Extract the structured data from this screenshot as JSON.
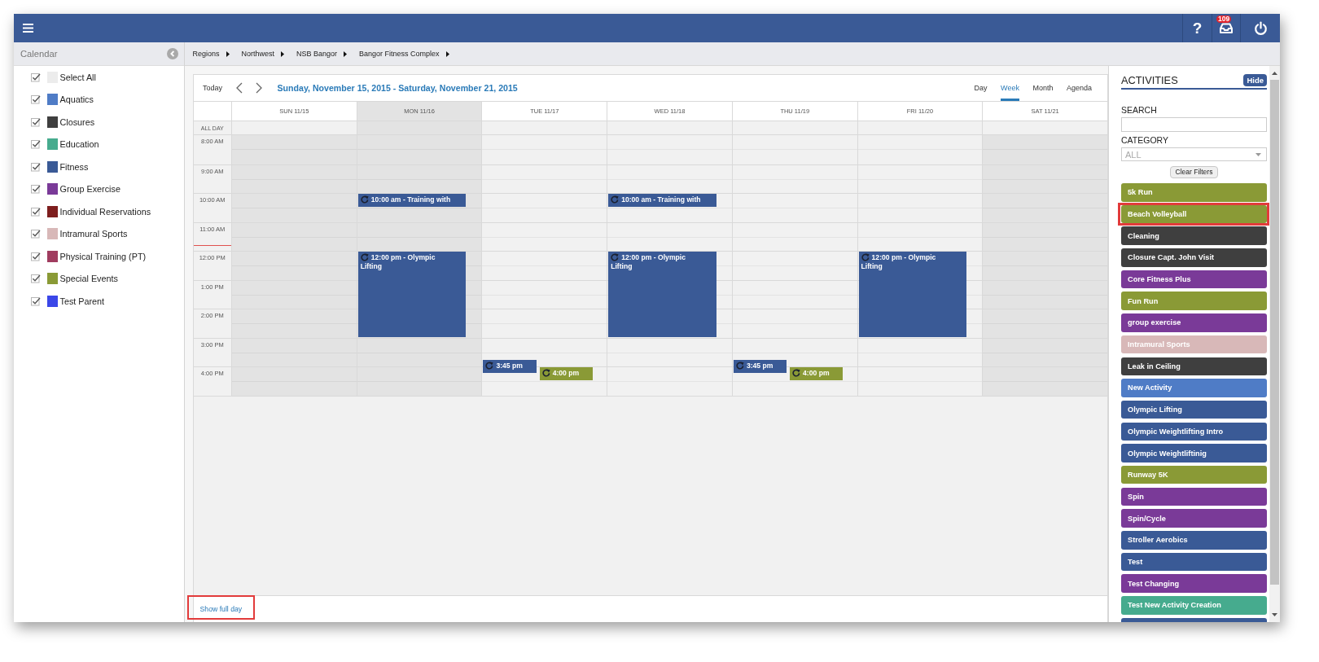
{
  "top_bar": {
    "help_label": "?",
    "notification_count": "109"
  },
  "sidebar": {
    "title": "Calendar",
    "items": [
      {
        "label": "Select All",
        "checked": true,
        "color": "#ececec"
      },
      {
        "label": "Aquatics",
        "checked": true,
        "color": "#4f7cc6"
      },
      {
        "label": "Closures",
        "checked": true,
        "color": "#3f3f3f"
      },
      {
        "label": "Education",
        "checked": true,
        "color": "#46ab8e"
      },
      {
        "label": "Fitness",
        "checked": true,
        "color": "#3a5a96"
      },
      {
        "label": "Group Exercise",
        "checked": true,
        "color": "#7a3a98"
      },
      {
        "label": "Individual Reservations",
        "checked": true,
        "color": "#7e1e1e"
      },
      {
        "label": "Intramural Sports",
        "checked": true,
        "color": "#d8b8b8"
      },
      {
        "label": "Physical Training (PT)",
        "checked": true,
        "color": "#a03c5f"
      },
      {
        "label": "Special Events",
        "checked": true,
        "color": "#8a9a36"
      },
      {
        "label": "Test Parent",
        "checked": true,
        "color": "#3b47e8"
      }
    ]
  },
  "breadcrumb": [
    "Regions",
    "Northwest",
    "NSB Bangor",
    "Bangor Fitness Complex"
  ],
  "calendar": {
    "today_button": "Today",
    "range_title": "Sunday, November 15, 2015 - Saturday, November 21, 2015",
    "views": [
      {
        "label": "Day",
        "selected": false
      },
      {
        "label": "Week",
        "selected": true
      },
      {
        "label": "Month",
        "selected": false
      },
      {
        "label": "Agenda",
        "selected": false
      }
    ],
    "all_day_label": "ALL DAY",
    "hours": [
      {
        "label": "8:00 AM",
        "now": false
      },
      {
        "label": "9:00 AM",
        "now": false
      },
      {
        "label": "10:00 AM",
        "now": false
      },
      {
        "label": "11:00 AM",
        "now": true
      },
      {
        "label": "12:00 PM",
        "now": false
      },
      {
        "label": "1:00 PM",
        "now": false
      },
      {
        "label": "2:00 PM",
        "now": false
      },
      {
        "label": "3:00 PM",
        "now": false
      },
      {
        "label": "4:00 PM",
        "now": false
      }
    ],
    "days": [
      {
        "label": "SUN 11/15",
        "today": false,
        "closed": true
      },
      {
        "label": "MON 11/16",
        "today": true,
        "closed": false,
        "events": [
          {
            "label": "10:00 am - Training with",
            "kind": "short",
            "color": "#3a5a96",
            "recurring": true
          },
          {
            "label": "12:00 pm - Olympic Lifting",
            "kind": "long",
            "color": "#3a5a96",
            "recurring": true
          }
        ]
      },
      {
        "label": "TUE 11/17",
        "today": false,
        "closed": false,
        "events": [
          {
            "label": "3:45 pm",
            "kind": "short",
            "color": "#3a5a96",
            "recurring": true
          },
          {
            "label": "4:00 pm",
            "kind": "short",
            "color": "#8a9a36",
            "recurring": true
          }
        ]
      },
      {
        "label": "WED 11/18",
        "today": false,
        "closed": false,
        "events": [
          {
            "label": "10:00 am - Training with",
            "kind": "short",
            "color": "#3a5a96",
            "recurring": true
          },
          {
            "label": "12:00 pm - Olympic Lifting",
            "kind": "long",
            "color": "#3a5a96",
            "recurring": true
          }
        ]
      },
      {
        "label": "THU 11/19",
        "today": false,
        "closed": false,
        "events": [
          {
            "label": "3:45 pm",
            "kind": "short",
            "color": "#3a5a96",
            "recurring": true
          },
          {
            "label": "4:00 pm",
            "kind": "short",
            "color": "#8a9a36",
            "recurring": true
          }
        ]
      },
      {
        "label": "FRI 11/20",
        "today": false,
        "closed": false,
        "events": [
          {
            "label": "12:00 pm - Olympic Lifting",
            "kind": "long",
            "color": "#3a5a96",
            "recurring": true
          }
        ]
      },
      {
        "label": "SAT 11/21",
        "today": false,
        "closed": true
      }
    ],
    "show_full_day": {
      "label": "Show full day",
      "highlighted": true
    }
  },
  "activities": {
    "title": "ACTIVITIES",
    "hide_button": "Hide",
    "search": {
      "label": "SEARCH"
    },
    "category": {
      "label": "CATEGORY",
      "placeholder": "ALL"
    },
    "clear_button": "Clear Filters",
    "items": [
      {
        "label": "5k Run",
        "color": "#8a9a36",
        "highlighted": false
      },
      {
        "label": "Beach Volleyball",
        "color": "#8a9a36",
        "highlighted": true
      },
      {
        "label": "Cleaning",
        "color": "#3f3f3f",
        "highlighted": false
      },
      {
        "label": "Closure Capt. John Visit",
        "color": "#3f3f3f",
        "highlighted": false
      },
      {
        "label": "Core Fitness Plus",
        "color": "#7a3a98",
        "highlighted": false
      },
      {
        "label": "Fun Run",
        "color": "#8a9a36",
        "highlighted": false
      },
      {
        "label": "group exercise",
        "color": "#7a3a98",
        "highlighted": false
      },
      {
        "label": "Intramural Sports",
        "color": "#d8b8b8",
        "highlighted": false
      },
      {
        "label": "Leak in Ceiling",
        "color": "#3f3f3f",
        "highlighted": false
      },
      {
        "label": "New Activity",
        "color": "#4f7cc6",
        "highlighted": false
      },
      {
        "label": "Olympic Lifting",
        "color": "#3a5a96",
        "highlighted": false
      },
      {
        "label": "Olympic Weightlifting Intro",
        "color": "#3a5a96",
        "highlighted": false
      },
      {
        "label": "Olympic Weightliftinig",
        "color": "#3a5a96",
        "highlighted": false
      },
      {
        "label": "Runway 5K",
        "color": "#8a9a36",
        "highlighted": false
      },
      {
        "label": "Spin",
        "color": "#7a3a98",
        "highlighted": false
      },
      {
        "label": "Spin/Cycle",
        "color": "#7a3a98",
        "highlighted": false
      },
      {
        "label": "Stroller Aerobics",
        "color": "#3a5a96",
        "highlighted": false
      },
      {
        "label": "Test",
        "color": "#3a5a96",
        "highlighted": false
      },
      {
        "label": "Test Changing",
        "color": "#7a3a98",
        "highlighted": false
      },
      {
        "label": "Test New Activity Creation",
        "color": "#46ab8e",
        "highlighted": false
      },
      {
        "color": "#3a5a96",
        "highlighted": false
      }
    ]
  }
}
